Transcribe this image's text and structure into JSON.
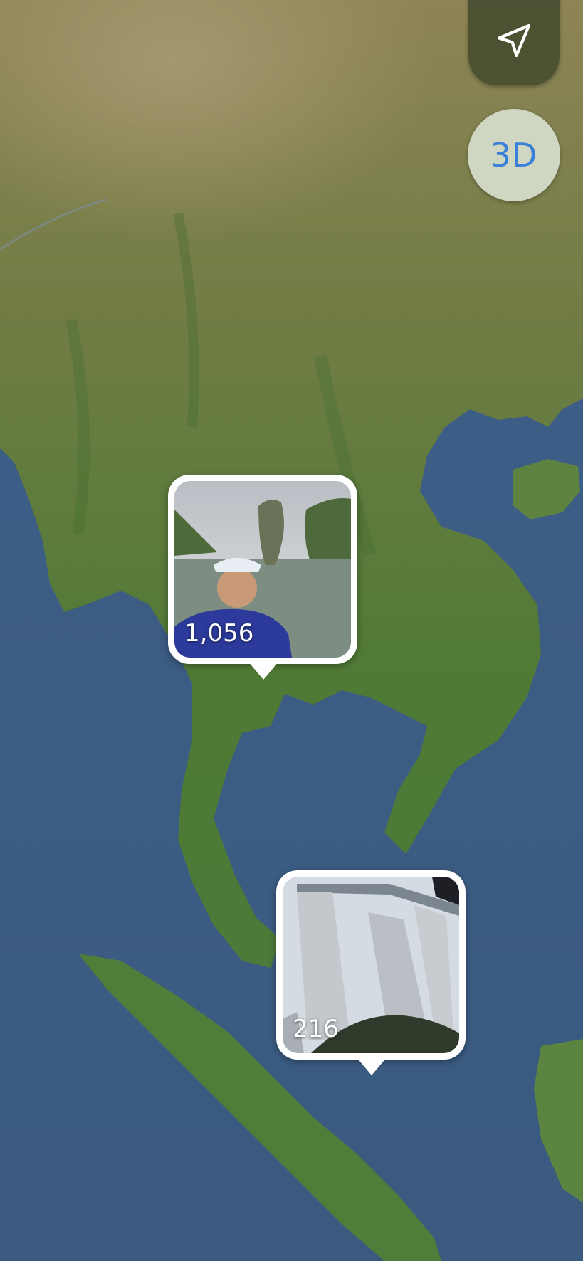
{
  "map": {
    "style": "satellite",
    "land_color": "#5d7f3a",
    "water_color": "#3e5f86"
  },
  "controls": {
    "locate_icon": "location-arrow-icon",
    "view_toggle_label": "3D",
    "accent_color": "#3a7fd8"
  },
  "pins": [
    {
      "count": "1,056",
      "photo": "selfie-with-limestone-rock-in-sea"
    },
    {
      "count": "216",
      "photo": "tall-hotel-towers-with-rooftop-deck"
    }
  ]
}
